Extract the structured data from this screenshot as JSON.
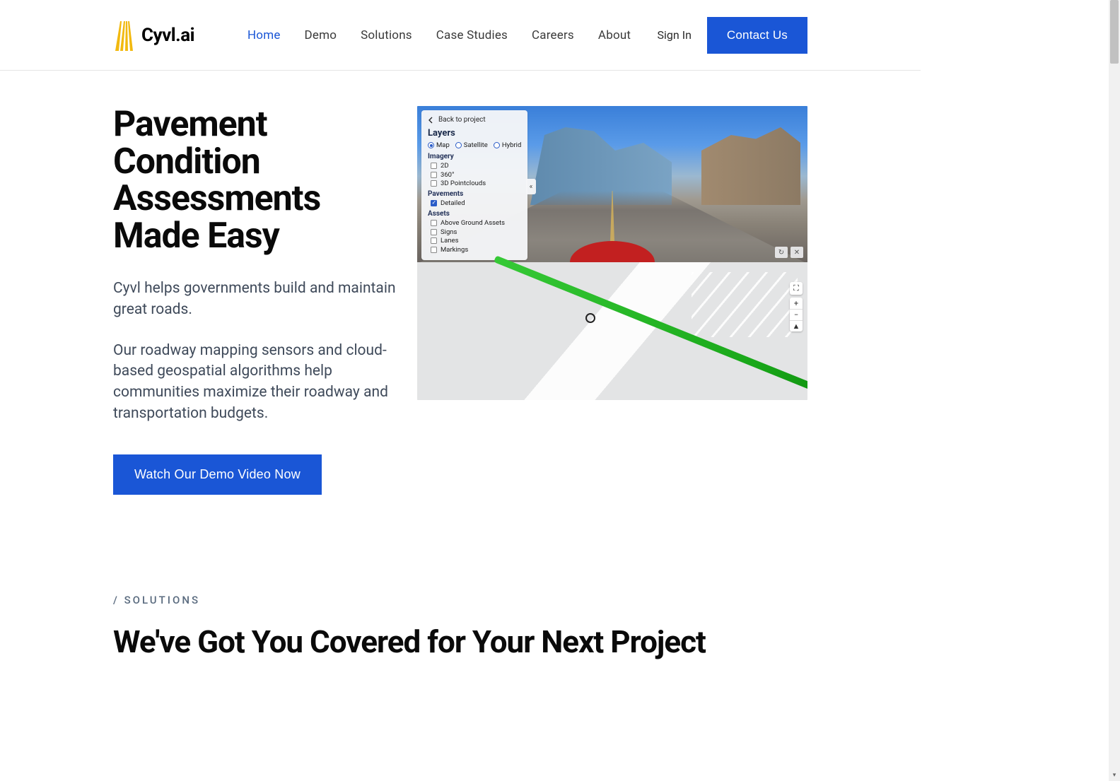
{
  "brand": {
    "name": "Cyvl.ai"
  },
  "nav": {
    "links": [
      {
        "label": "Home",
        "active": true
      },
      {
        "label": "Demo",
        "active": false
      },
      {
        "label": "Solutions",
        "active": false
      },
      {
        "label": "Case Studies",
        "active": false
      },
      {
        "label": "Careers",
        "active": false
      },
      {
        "label": "About",
        "active": false
      }
    ],
    "signin": "Sign In",
    "contact": "Contact Us"
  },
  "hero": {
    "title": "Pavement Condition Assessments Made Easy",
    "p1": "Cyvl helps governments build and maintain great roads.",
    "p2": "Our roadway mapping sensors and cloud-based geospatial algorithms help communities maximize their roadway and transportation budgets.",
    "cta": "Watch Our Demo Video Now"
  },
  "panel": {
    "back": "Back to project",
    "title": "Layers",
    "basemaps": [
      {
        "label": "Map",
        "on": true
      },
      {
        "label": "Satellite",
        "on": false
      },
      {
        "label": "Hybrid",
        "on": false
      }
    ],
    "sections": {
      "imagery": {
        "label": "Imagery",
        "items": [
          {
            "label": "2D",
            "on": false
          },
          {
            "label": "360°",
            "on": false
          },
          {
            "label": "3D Pointclouds",
            "on": false
          }
        ]
      },
      "pavements": {
        "label": "Pavements",
        "items": [
          {
            "label": "Detailed",
            "on": true
          }
        ]
      },
      "assets": {
        "label": "Assets",
        "items": [
          {
            "label": "Above Ground Assets",
            "on": false
          },
          {
            "label": "Signs",
            "on": false
          },
          {
            "label": "Lanes",
            "on": false
          },
          {
            "label": "Markings",
            "on": false
          }
        ]
      }
    }
  },
  "map_controls": {
    "expand": "⛶",
    "zoom_in": "+",
    "zoom_out": "−",
    "compass": "▲",
    "refresh": "↻",
    "close": "✕",
    "collapse": "«"
  },
  "solutions": {
    "eyebrow": "/ SOLUTIONS",
    "title": "We've Got You Covered for Your Next Project"
  }
}
